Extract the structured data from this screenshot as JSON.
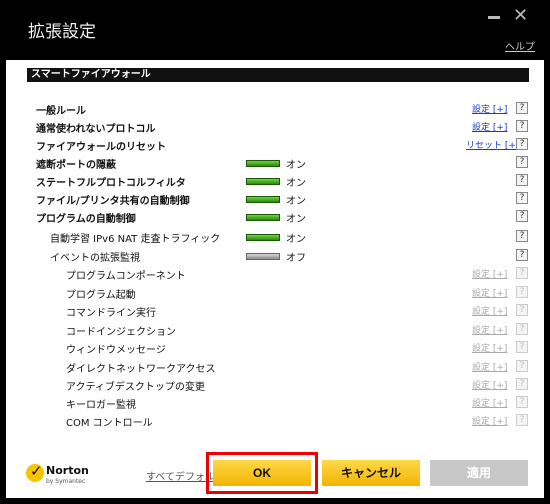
{
  "window": {
    "title": "拡張設定",
    "help_link": "ヘルプ",
    "minimize_icon": "minimize-icon",
    "close_icon": "close-icon"
  },
  "section": {
    "title": "スマートファイアウォール"
  },
  "rows": [
    {
      "label": "一般ルール",
      "link": "設定 [+]",
      "help": "?"
    },
    {
      "label": "通常使われないプロトコル",
      "link": "設定 [+]",
      "help": "?"
    },
    {
      "label": "ファイアウォールのリセット",
      "link": "リセット [+]",
      "help": "?"
    },
    {
      "label": "遮断ポートの隠蔽",
      "state": "オン",
      "help": "?"
    },
    {
      "label": "ステートフルプロトコルフィルタ",
      "state": "オン",
      "help": "?"
    },
    {
      "label": "ファイル/プリンタ共有の自動制御",
      "state": "オン",
      "help": "?"
    },
    {
      "label": "プログラムの自動制御",
      "state": "オン",
      "help": "?"
    },
    {
      "label": "自動学習 IPv6 NAT 走査トラフィック",
      "state": "オン",
      "help": "?"
    },
    {
      "label": "イベントの拡張監視",
      "state": "オフ",
      "help": "?"
    },
    {
      "label": "プログラムコンポーネント",
      "link": "設定 [+]",
      "help": "?"
    },
    {
      "label": "プログラム起動",
      "link": "設定 [+]",
      "help": "?"
    },
    {
      "label": "コマンドライン実行",
      "link": "設定 [+]",
      "help": "?"
    },
    {
      "label": "コードインジェクション",
      "link": "設定 [+]",
      "help": "?"
    },
    {
      "label": "ウィンドウメッセージ",
      "link": "設定 [+]",
      "help": "?"
    },
    {
      "label": "ダイレクトネットワークアクセス",
      "link": "設定 [+]",
      "help": "?"
    },
    {
      "label": "アクティブデスクトップの変更",
      "link": "設定 [+]",
      "help": "?"
    },
    {
      "label": "キーロガー監視",
      "link": "設定 [+]",
      "help": "?"
    },
    {
      "label": "COM コントロール",
      "link": "設定 [+]",
      "help": "?"
    }
  ],
  "footer": {
    "brand": "Norton",
    "brand_sub": "by Symantec",
    "defaults_link": "すべてデフォルト",
    "ok": "OK",
    "cancel": "キャンセル",
    "apply": "適用"
  },
  "colors": {
    "toggle_on": "#3fb51c",
    "button_yellow": "#f7c600",
    "highlight_frame": "#e00000",
    "link_blue": "#1a3ec8"
  }
}
